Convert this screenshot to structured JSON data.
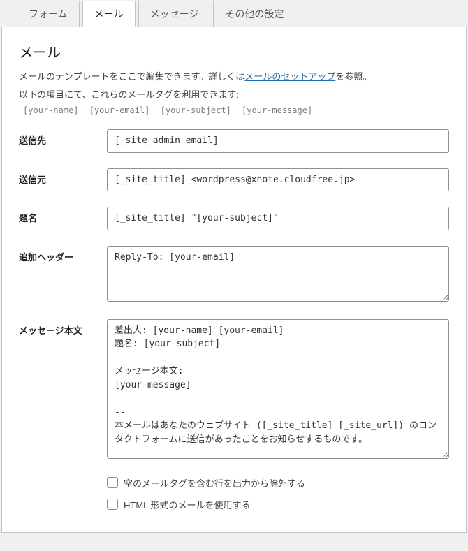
{
  "tabs": {
    "form": "フォーム",
    "mail": "メール",
    "messages": "メッセージ",
    "other": "その他の設定"
  },
  "heading": "メール",
  "desc_prefix": "メールのテンプレートをここで編集できます。詳しくは",
  "desc_link": "メールのセットアップ",
  "desc_suffix": "を参照。",
  "desc_line2": "以下の項目にて、これらのメールタグを利用できます:",
  "tags": {
    "t1": "[your-name]",
    "t2": "[your-email]",
    "t3": "[your-subject]",
    "t4": "[your-message]"
  },
  "labels": {
    "recipient": "送信先",
    "sender": "送信元",
    "subject": "題名",
    "headers": "追加ヘッダー",
    "body": "メッセージ本文"
  },
  "fields": {
    "recipient": "[_site_admin_email]",
    "sender": "[_site_title] <wordpress@xnote.cloudfree.jp>",
    "subject": "[_site_title] \"[your-subject]\"",
    "headers": "Reply-To: [your-email]",
    "body": "差出人: [your-name] [your-email]\n題名: [your-subject]\n\nメッセージ本文:\n[your-message]\n\n-- \n本メールはあなたのウェブサイト ([_site_title] [_site_url]) のコンタクトフォームに送信があったことをお知らせするものです。"
  },
  "checkboxes": {
    "exclude_blank": "空のメールタグを含む行を出力から除外する",
    "use_html": "HTML 形式のメールを使用する"
  }
}
